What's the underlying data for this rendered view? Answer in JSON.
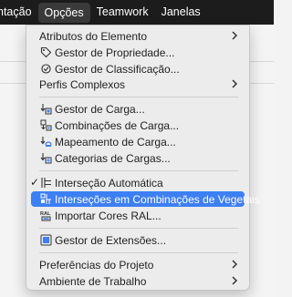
{
  "menubar": {
    "items": [
      {
        "label": "ntação"
      },
      {
        "label": "Opções"
      },
      {
        "label": "Teamwork"
      },
      {
        "label": "Janelas"
      }
    ]
  },
  "menu": {
    "items": [
      {
        "label": "Atributos do Elemento"
      },
      {
        "label": "Gestor de Propriedade..."
      },
      {
        "label": "Gestor de Classificação..."
      },
      {
        "label": "Perfis Complexos"
      },
      {
        "label": "Gestor de Carga..."
      },
      {
        "label": "Combinações de Carga..."
      },
      {
        "label": "Mapeamento de Carga..."
      },
      {
        "label": "Categorias de Cargas..."
      },
      {
        "label": "Interseção Automática",
        "checked": true
      },
      {
        "label": "Interseções em Combinações de Vegetais",
        "selected": true
      },
      {
        "label": "Importar Cores RAL..."
      },
      {
        "label": "Gestor de Extensões..."
      },
      {
        "label": "Preferências do Projeto"
      },
      {
        "label": "Ambiente de Trabalho"
      }
    ],
    "highlight_color": "#3d7ff5"
  }
}
